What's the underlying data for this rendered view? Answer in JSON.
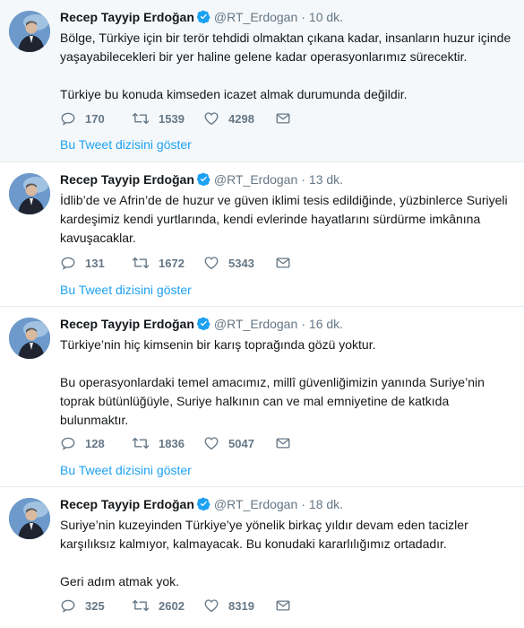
{
  "tweets": [
    {
      "name": "Recep Tayyip Erdoğan",
      "handle": "@RT_Erdogan",
      "separator": "·",
      "time": "10 dk.",
      "paragraphs": [
        "Bölge, Türkiye için bir terör tehdidi olmaktan çıkana kadar, insanların huzur içinde yaşayabilecekleri bir yer haline gelene kadar operasyonlarımız sürecektir.",
        "Türkiye bu konuda kimseden icazet almak durumunda değildir."
      ],
      "replies": "170",
      "retweets": "1539",
      "likes": "4298",
      "thread_link": "Bu Tweet dizisini göster"
    },
    {
      "name": "Recep Tayyip Erdoğan",
      "handle": "@RT_Erdogan",
      "separator": "·",
      "time": "13 dk.",
      "paragraphs": [
        "İdlib’de ve Afrin’de de huzur ve güven iklimi tesis edildiğinde, yüzbinlerce Suriyeli kardeşimiz kendi yurtlarında, kendi evlerinde hayatlarını sürdürme imkânına kavuşacaklar."
      ],
      "replies": "131",
      "retweets": "1672",
      "likes": "5343",
      "thread_link": "Bu Tweet dizisini göster"
    },
    {
      "name": "Recep Tayyip Erdoğan",
      "handle": "@RT_Erdogan",
      "separator": "·",
      "time": "16 dk.",
      "paragraphs": [
        "Türkiye’nin hiç kimsenin bir karış toprağında gözü yoktur.",
        "Bu operasyonlardaki temel amacımız, millî güvenliğimizin yanında Suriye’nin toprak bütünlüğüyle, Suriye halkının can ve mal emniyetine de katkıda bulunmaktır."
      ],
      "replies": "128",
      "retweets": "1836",
      "likes": "5047",
      "thread_link": "Bu Tweet dizisini göster"
    },
    {
      "name": "Recep Tayyip Erdoğan",
      "handle": "@RT_Erdogan",
      "separator": "·",
      "time": "18 dk.",
      "paragraphs": [
        "Suriye’nin kuzeyinden Türkiye’ye yönelik birkaç yıldır devam eden tacizler karşılıksız kalmıyor, kalmayacak. Bu konudaki kararlılığımız ortadadır.",
        "Geri adım atmak yok."
      ],
      "replies": "325",
      "retweets": "2602",
      "likes": "8319",
      "thread_link": ""
    }
  ],
  "icons": {
    "reply": "reply-icon",
    "retweet": "retweet-icon",
    "like": "heart-icon",
    "dm": "envelope-icon",
    "verified": "verified-badge-icon"
  },
  "colors": {
    "link": "#1da1f2",
    "secondary_text": "#657786",
    "verified": "#1da1f2",
    "first_tweet_bg": "#f5f8fa"
  }
}
